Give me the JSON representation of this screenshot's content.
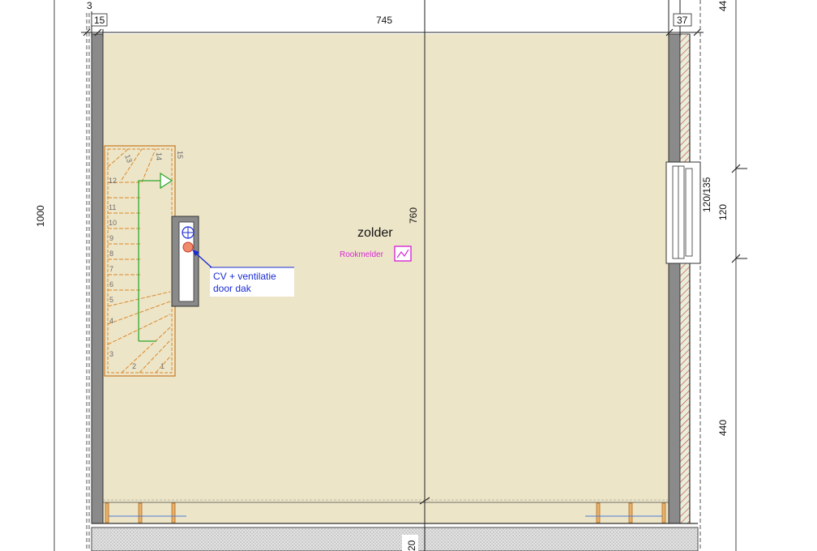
{
  "plan": {
    "room_label": "zolder",
    "smoke_label": "Rookmelder",
    "callout": {
      "line1": "CV + ventilatie",
      "line2": "door dak"
    },
    "dimensions": {
      "top_left_small": "3",
      "top_left": "15",
      "top_main": "745",
      "top_right": "37",
      "top_far_right": "44",
      "left_overall": "1000",
      "room_height": "760",
      "window_size": "120/135",
      "right_mid": "120",
      "right_lower": "440",
      "bottom": "20"
    },
    "stair_numbers": [
      "1",
      "2",
      "3",
      "4",
      "5",
      "6",
      "7",
      "8",
      "9",
      "10",
      "11",
      "12",
      "13",
      "14",
      "15"
    ]
  },
  "colors": {
    "floor": "#ede5c8",
    "wall": "#8a8a8a",
    "stair_lines": "#d9892a",
    "stair_path": "#2fa82f",
    "callout_text": "#1a2bd6",
    "smoke": "#d42bd4",
    "hatch": "#c43a2a",
    "insulation": "#e8eedd"
  }
}
